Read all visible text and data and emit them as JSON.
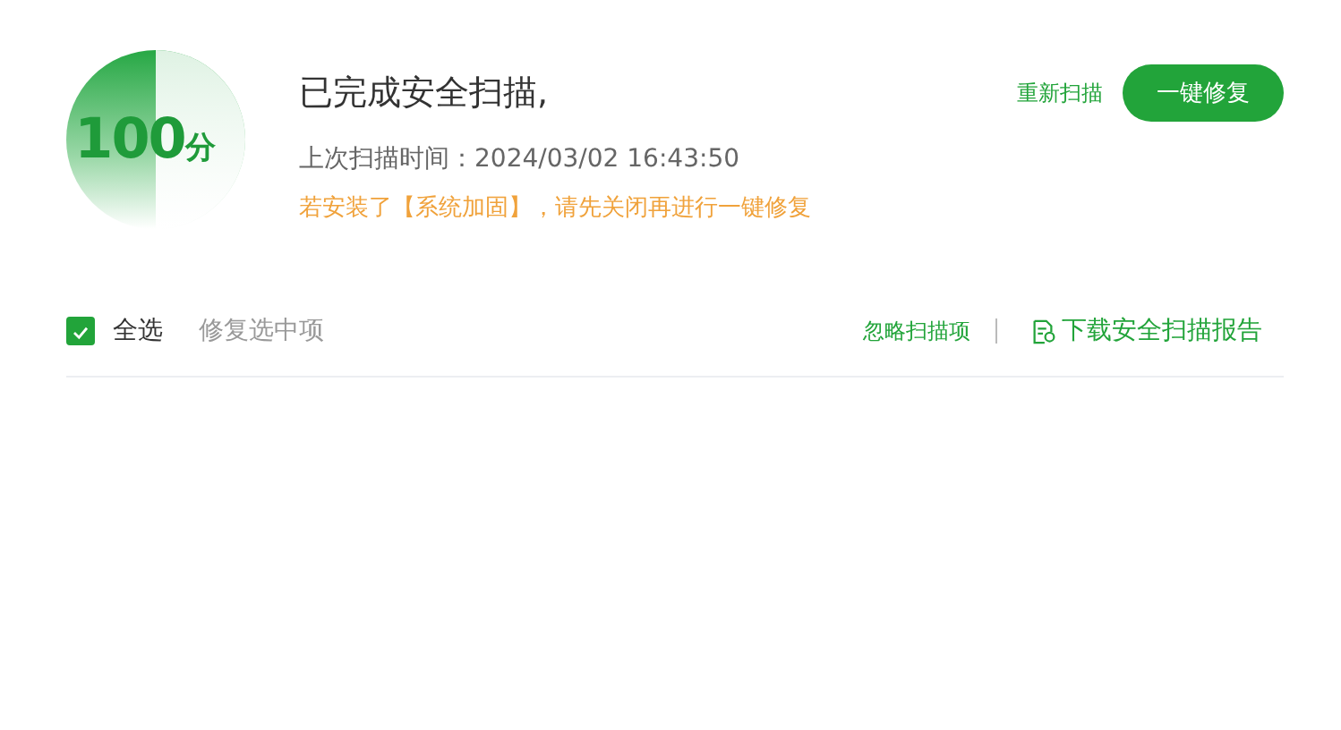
{
  "score": {
    "value": "100",
    "unit": "分"
  },
  "title": "已完成安全扫描,",
  "last_scan": "上次扫描时间：2024/03/02 16:43:50",
  "warning": "若安装了【系统加固】，请先关闭再进行一键修复",
  "rescan_link": "重新扫描",
  "fix_button": "一键修复",
  "toolbar": {
    "select_all": {
      "label": "全选",
      "checked": true
    },
    "fix_selected": {
      "label": "修复选中项",
      "disabled": true
    },
    "ignore_link": "忽略扫描项",
    "download_link": "下载安全扫描报告"
  }
}
